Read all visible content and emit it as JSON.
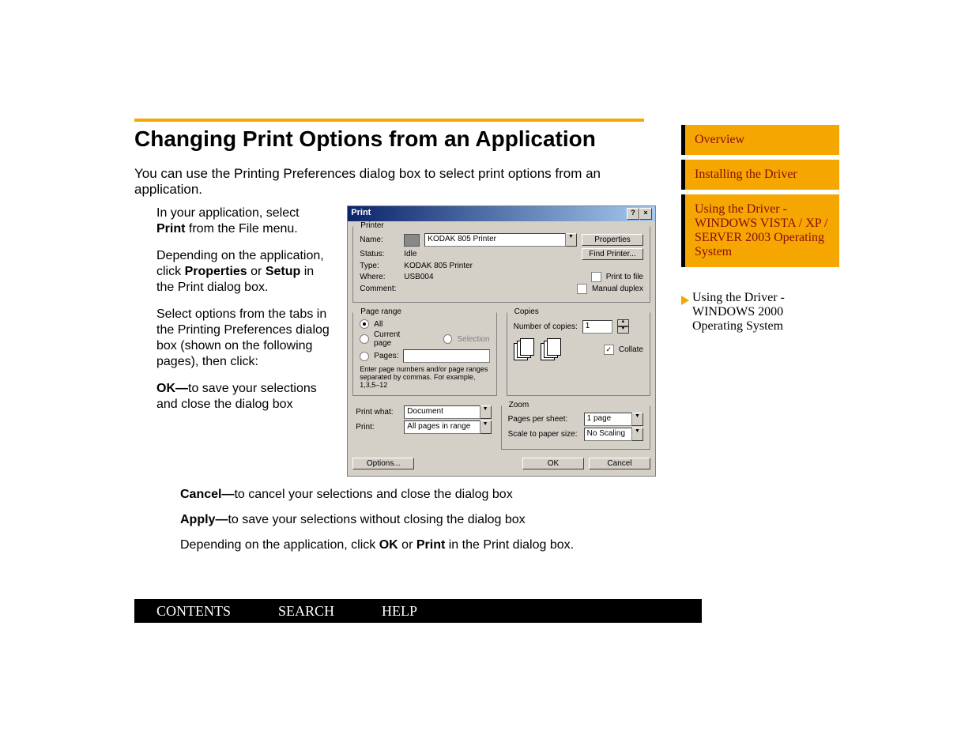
{
  "heading": "Changing Print Options from an Application",
  "intro": "You can use the Printing Preferences dialog box to select print options from an application.",
  "steps": {
    "s1a": "In your application, select ",
    "s1b": "Print",
    "s1c": " from the File menu.",
    "s2a": "Depending on the application, click ",
    "s2b": "Properties",
    "s2c": " or ",
    "s2d": "Setup",
    "s2e": " in the Print dialog box.",
    "s3": "Select options from the tabs in the Printing Preferences dialog box (shown on the following pages), then click:",
    "s4a": "OK—",
    "s4b": "to save your selections and close the dialog box"
  },
  "below": {
    "b1a": "Cancel—",
    "b1b": "to cancel your selections and close the dialog box",
    "b2a": "Apply—",
    "b2b": "to save your selections without closing the dialog box",
    "b3a": "Depending on the application, click ",
    "b3b": "OK",
    "b3c": " or ",
    "b3d": "Print",
    "b3e": " in the Print dialog box."
  },
  "nav": {
    "overview": "Overview",
    "installing": "Installing the Driver",
    "vista": "Using the Driver - WINDOWS VISTA / XP / SERVER 2003 Operating System",
    "w2000": "Using the Driver - WINDOWS 2000 Operating System"
  },
  "footer": {
    "contents": "CONTENTS",
    "search": "SEARCH",
    "help": "HELP"
  },
  "dlg": {
    "title": "Print",
    "help_btn": "?",
    "close_btn": "×",
    "printer_legend": "Printer",
    "name_label": "Name:",
    "name_value": "KODAK 805 Printer",
    "status_label": "Status:",
    "status_value": "Idle",
    "type_label": "Type:",
    "type_value": "KODAK 805 Printer",
    "where_label": "Where:",
    "where_value": "USB004",
    "comment_label": "Comment:",
    "properties_btn": "Properties",
    "findprinter_btn": "Find Printer...",
    "print_to_file": "Print to file",
    "manual_duplex": "Manual duplex",
    "pagerange_legend": "Page range",
    "all": "All",
    "current": "Current page",
    "selection": "Selection",
    "pages": "Pages:",
    "pages_hint": "Enter page numbers and/or page ranges separated by commas.  For example, 1,3,5–12",
    "copies_legend": "Copies",
    "num_copies": "Number of copies:",
    "copies_value": "1",
    "collate": "Collate",
    "print_what_label": "Print what:",
    "print_what_value": "Document",
    "print_label": "Print:",
    "print_value": "All pages in range",
    "zoom_legend": "Zoom",
    "pps_label": "Pages per sheet:",
    "pps_value": "1 page",
    "scale_label": "Scale to paper size:",
    "scale_value": "No Scaling",
    "options_btn": "Options...",
    "ok_btn": "OK",
    "cancel_btn": "Cancel"
  }
}
